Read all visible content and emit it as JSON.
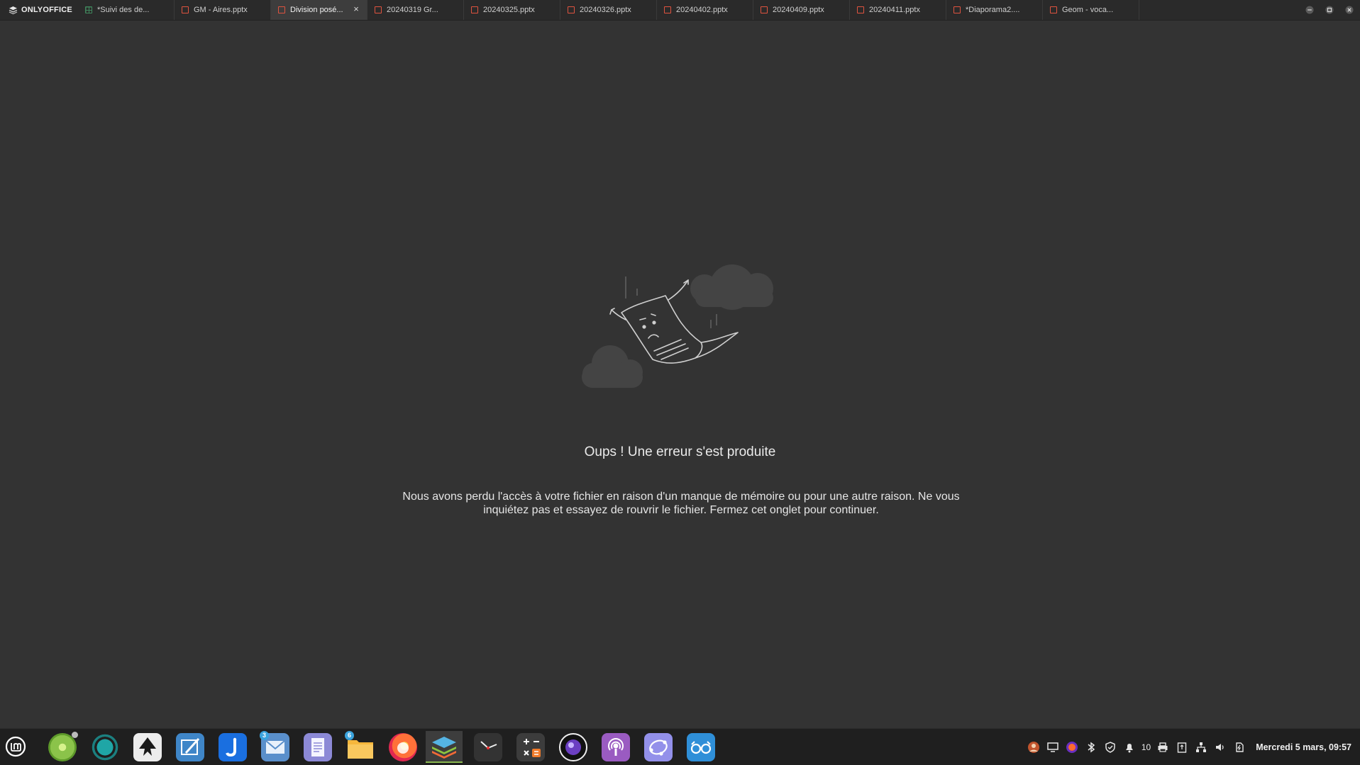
{
  "app": {
    "name": "ONLYOFFICE"
  },
  "tabs": [
    {
      "label": "*Suivi des de...",
      "type": "spreadsheet",
      "active": false
    },
    {
      "label": "GM - Aires.pptx",
      "type": "presentation",
      "active": false
    },
    {
      "label": "Division posé...",
      "type": "presentation",
      "active": true
    },
    {
      "label": "20240319 Gr...",
      "type": "presentation",
      "active": false
    },
    {
      "label": "20240325.pptx",
      "type": "presentation",
      "active": false
    },
    {
      "label": "20240326.pptx",
      "type": "presentation",
      "active": false
    },
    {
      "label": "20240402.pptx",
      "type": "presentation",
      "active": false
    },
    {
      "label": "20240409.pptx",
      "type": "presentation",
      "active": false
    },
    {
      "label": "20240411.pptx",
      "type": "presentation",
      "active": false
    },
    {
      "label": "*Diaporama2....",
      "type": "presentation",
      "active": false
    },
    {
      "label": "Geom - voca...",
      "type": "presentation",
      "active": false
    }
  ],
  "tab_close_glyph": "×",
  "error": {
    "title": "Oups ! Une erreur s'est produite",
    "message": "Nous avons perdu l'accès à votre fichier en raison d'un manque de mémoire ou pour une autre raison. Ne vous inquiétez pas et essayez de rouvrir le fichier. Fermez cet onglet pour continuer."
  },
  "taskbar": {
    "launchers": [
      {
        "name": "disc-burner-icon",
        "color": "#7bc043"
      },
      {
        "name": "settings-ring-icon",
        "color": "#1b8c8c"
      },
      {
        "name": "inkscape-icon",
        "color": "#e8e8e8"
      },
      {
        "name": "drawing-app-icon",
        "color": "#3b7fc4"
      },
      {
        "name": "joplin-icon",
        "color": "#1a73e8"
      },
      {
        "name": "mail-icon",
        "color": "#4f86c6",
        "badge": "3"
      },
      {
        "name": "text-editor-icon",
        "color": "#8f8bd8"
      },
      {
        "name": "file-manager-icon",
        "color": "#f5b13d",
        "badge": "6"
      },
      {
        "name": "firefox-icon",
        "color": "#ff5a36"
      },
      {
        "name": "onlyoffice-icon",
        "color": "#55a4d9",
        "active": true
      },
      {
        "name": "clock-app-icon",
        "color": "#3a3a3a"
      },
      {
        "name": "calculator-icon",
        "color": "#444444"
      },
      {
        "name": "screen-recorder-icon",
        "color": "#6a3db8"
      },
      {
        "name": "podcast-icon",
        "color": "#9b59b6"
      },
      {
        "name": "geometry-app-icon",
        "color": "#8e8ee8"
      },
      {
        "name": "accessibility-glasses-icon",
        "color": "#2f8fd8"
      }
    ],
    "tray": {
      "notifications_count": "10",
      "clock": "Mercredi 5 mars, 09:57"
    }
  }
}
